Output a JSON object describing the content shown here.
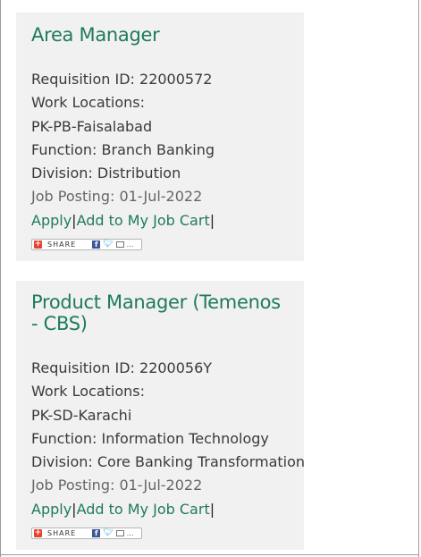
{
  "jobs": [
    {
      "title": "Area Manager",
      "requisition": "Requisition ID: 22000572",
      "work_locations_label": "Work Locations:",
      "location": "PK-PB-Faisalabad",
      "function": "Function: Branch Banking",
      "division": "Division: Distribution",
      "posting": "Job Posting: 01-Jul-2022",
      "apply": "Apply",
      "separator": "|",
      "add_to_cart": "Add to My Job Cart",
      "share_label": "SHARE"
    },
    {
      "title": "Product Manager (Temenos - CBS)",
      "requisition": "Requisition ID: 2200056Y",
      "work_locations_label": "Work Locations:",
      "location": "PK-SD-Karachi",
      "function": "Function: Information Technology",
      "division": "Division: Core Banking Transformation",
      "posting": "Job Posting: 01-Jul-2022",
      "apply": "Apply",
      "separator": "|",
      "add_to_cart": "Add to My Job Cart",
      "share_label": "SHARE"
    }
  ]
}
